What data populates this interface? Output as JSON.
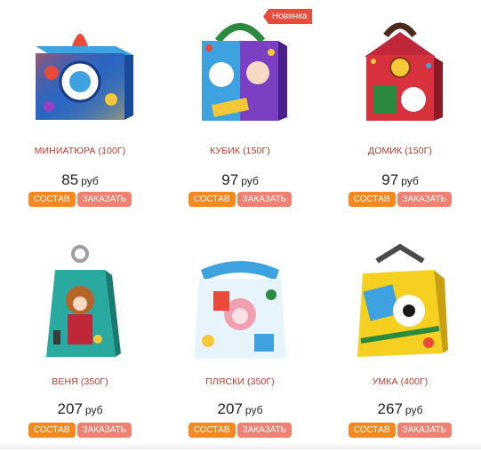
{
  "badge_new": "Новинка",
  "products": [
    {
      "title": "МИНИАТЮРА (100Г)",
      "price": "85",
      "currency": "руб",
      "sostav": "СОСТАВ",
      "order": "ЗАКАЗАТЬ"
    },
    {
      "title": "КУБИК (150Г)",
      "price": "97",
      "currency": "руб",
      "sostav": "СОСТАВ",
      "order": "ЗАКАЗАТЬ"
    },
    {
      "title": "ДОМИК (150Г)",
      "price": "97",
      "currency": "руб",
      "sostav": "СОСТАВ",
      "order": "ЗАКАЗАТЬ"
    },
    {
      "title": "ВЕНЯ (350Г)",
      "price": "207",
      "currency": "руб",
      "sostav": "СОСТАВ",
      "order": "ЗАКАЗАТЬ"
    },
    {
      "title": "ПЛЯСКИ (350Г)",
      "price": "207",
      "currency": "руб",
      "sostav": "СОСТАВ",
      "order": "ЗАКАЗАТЬ"
    },
    {
      "title": "УМКА (400Г)",
      "price": "267",
      "currency": "руб",
      "sostav": "СОСТАВ",
      "order": "ЗАКАЗАТЬ"
    }
  ],
  "colors": {
    "accent_orange": "#f5891f",
    "accent_salmon": "#f08070",
    "title_red": "#c0392b",
    "badge_red": "#e84c3d"
  },
  "icons": [
    "gift-box-miniatura-image",
    "gift-box-kubik-image",
    "gift-box-domik-image",
    "gift-box-venya-image",
    "gift-box-plyaski-image",
    "gift-box-umka-image"
  ]
}
